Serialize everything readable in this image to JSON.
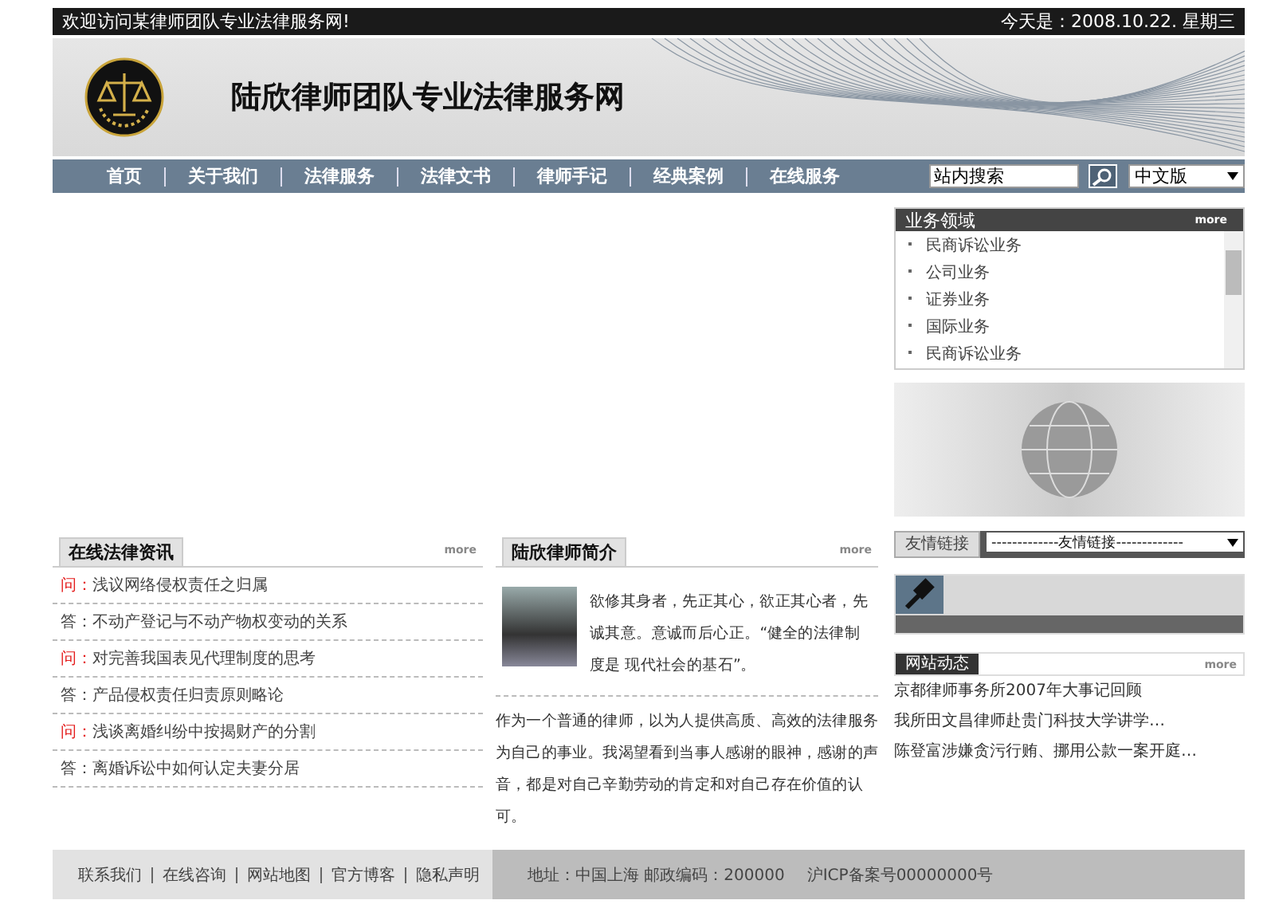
{
  "top_bar": {
    "welcome": "欢迎访问某律师团队专业法律服务网!",
    "date": "今天是：2008.10.22.  星期三"
  },
  "header": {
    "title": "陆欣律师团队专业法律服务网"
  },
  "nav": {
    "items": [
      "首页",
      "关于我们",
      "法律服务",
      "法律文书",
      "律师手记",
      "经典案例",
      "在线服务"
    ],
    "search": {
      "value": "站内搜索"
    },
    "language": "中文版"
  },
  "news_panel": {
    "title": "在线法律资讯",
    "more": "more",
    "items": [
      {
        "kind": "question",
        "prefix": "问：",
        "text": "浅议网络侵权责任之归属"
      },
      {
        "kind": "answer",
        "prefix": "答：",
        "text": "不动产登记与不动产物权变动的关系"
      },
      {
        "kind": "question",
        "prefix": "问：",
        "text": "对完善我国表见代理制度的思考"
      },
      {
        "kind": "answer",
        "prefix": "答：",
        "text": "产品侵权责任归责原则略论"
      },
      {
        "kind": "question",
        "prefix": "问：",
        "text": "浅谈离婚纠纷中按揭财产的分割"
      },
      {
        "kind": "answer",
        "prefix": "答：",
        "text": "离婚诉讼中如何认定夫妻分居"
      }
    ]
  },
  "about_panel": {
    "title": "陆欣律师简介",
    "more": "more",
    "intro": "欲修其身者，先正其心，欲正其心者，先诚其意。意诚而后心正。“健全的法律制度是 现代社会的基石”。",
    "body": "作为一个普通的律师，以为人提供高质、高效的法律服务为自己的事业。我渴望看到当事人感谢的眼神，感谢的声音，都是对自己辛勤劳动的肯定和对自己存在价值的认可。"
  },
  "business_areas": {
    "title": "业务领域",
    "more": "more",
    "items": [
      "民商诉讼业务",
      "公司业务",
      "证券业务",
      "国际业务",
      "民商诉讼业务"
    ]
  },
  "friend_links": {
    "label": "友情链接",
    "select": "-------------友情链接-------------"
  },
  "site_news": {
    "title": "网站动态",
    "more": "more",
    "items": [
      "京都律师事务所2007年大事记回顾",
      "我所田文昌律师赴贵门科技大学讲学…",
      "陈登富涉嫌贪污行贿、挪用公款一案开庭…"
    ]
  },
  "footer": {
    "links": [
      "联系我们",
      "在线咨询",
      "网站地图",
      "官方博客",
      "隐私声明"
    ],
    "address": "地址：中国上海 邮政编码：200000",
    "icp": "沪ICP备案号00000000号"
  }
}
